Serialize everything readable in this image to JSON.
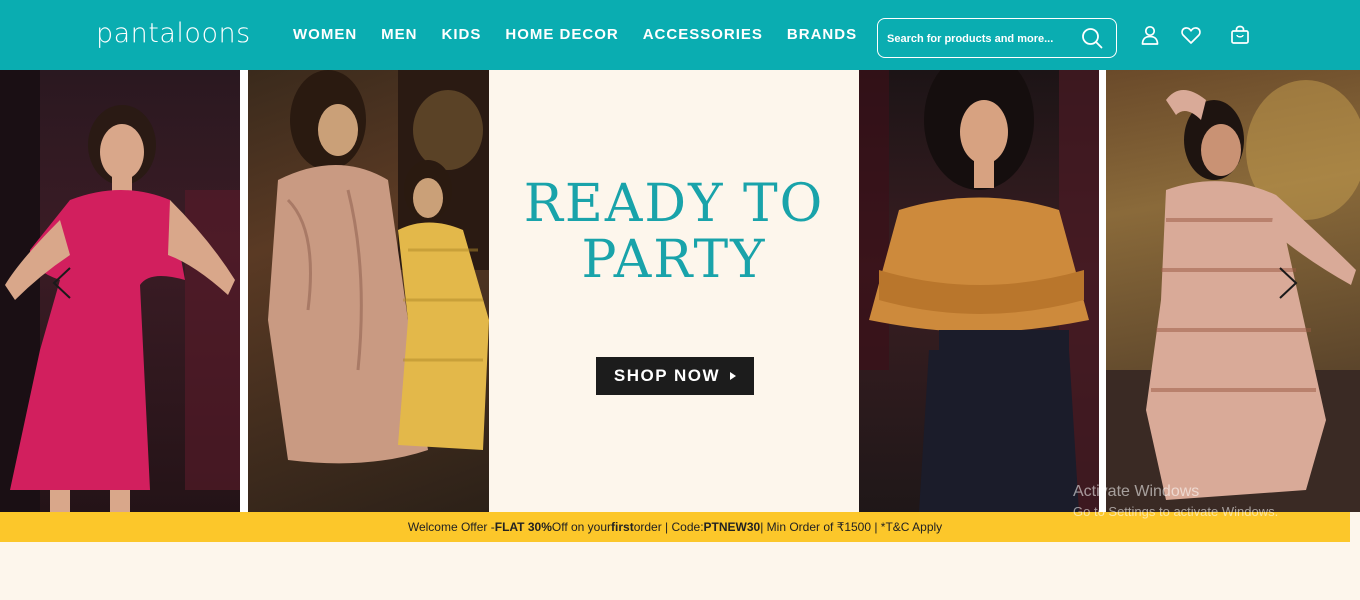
{
  "brand": {
    "logo_text": "pantaloons"
  },
  "nav": {
    "items": [
      {
        "label": "WOMEN"
      },
      {
        "label": "MEN"
      },
      {
        "label": "KIDS"
      },
      {
        "label": "HOME DECOR"
      },
      {
        "label": "ACCESSORIES"
      },
      {
        "label": "BRANDS"
      }
    ]
  },
  "search": {
    "placeholder": "Search for products and more..."
  },
  "header_icons": [
    "user-icon",
    "heart-icon",
    "bag-icon"
  ],
  "hero": {
    "title_line1": "READY TO",
    "title_line2": "PARTY",
    "cta_label": "SHOP NOW"
  },
  "offer": {
    "p1": "Welcome Offer - ",
    "b1": "FLAT 30%",
    "p2": " Off on your ",
    "b2": "first",
    "p3": " order | Code: ",
    "b3": "PTNEW30",
    "p4": " | Min Order of ₹1500 | *T&C Apply"
  },
  "watermark": {
    "line1": "Activate Windows",
    "line2": "Go to Settings to activate Windows."
  },
  "colors": {
    "header_bg": "#0aadb1",
    "accent_teal": "#19a3aa",
    "offer_bg": "#fcc72a",
    "page_bg": "#fdf6ec",
    "cta_bg": "#1c1c1c"
  }
}
